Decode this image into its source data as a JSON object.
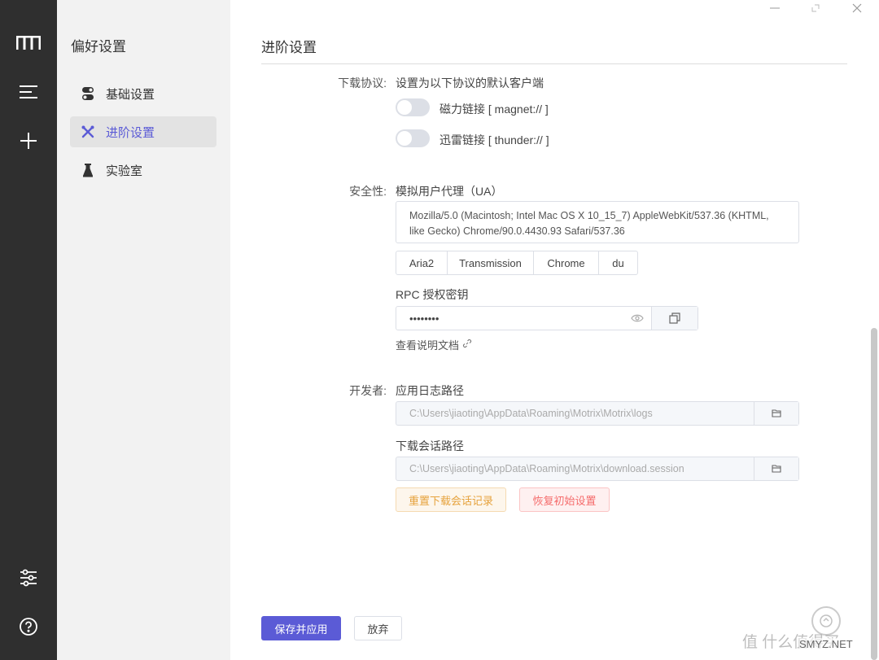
{
  "sidebar": {
    "title": "偏好设置",
    "items": [
      {
        "label": "基础设置",
        "icon": "toggle-icon"
      },
      {
        "label": "进阶设置",
        "icon": "tools-icon"
      },
      {
        "label": "实验室",
        "icon": "flask-icon"
      }
    ]
  },
  "main": {
    "title": "进阶设置",
    "protocol": {
      "label": "下载协议:",
      "description": "设置为以下协议的默认客户端",
      "magnet": "磁力链接 [ magnet:// ]",
      "thunder": "迅雷链接 [ thunder:// ]"
    },
    "security": {
      "label": "安全性:",
      "ua_title": "模拟用户代理（UA）",
      "ua_value": "Mozilla/5.0 (Macintosh; Intel Mac OS X 10_15_7) AppleWebKit/537.36 (KHTML, like Gecko) Chrome/90.0.4430.93 Safari/537.36",
      "ua_presets": [
        "Aria2",
        "Transmission",
        "Chrome",
        "du"
      ],
      "rpc_title": "RPC 授权密钥",
      "rpc_value": "••••••••",
      "docs_link": "查看说明文档"
    },
    "developer": {
      "label": "开发者:",
      "log_title": "应用日志路径",
      "log_path": "C:\\Users\\jiaoting\\AppData\\Roaming\\Motrix\\Motrix\\logs",
      "session_title": "下载会话路径",
      "session_path": "C:\\Users\\jiaoting\\AppData\\Roaming\\Motrix\\download.session",
      "reset_session": "重置下载会话记录",
      "factory_reset": "恢复初始设置"
    }
  },
  "footer": {
    "save": "保存并应用",
    "discard": "放弃"
  },
  "watermark": {
    "text": "值 什么值得买",
    "sub": "SMYZ.NET"
  },
  "colors": {
    "accent": "#5b5bd6",
    "rail": "#2f2f2f",
    "warning": "#e6a23c",
    "danger": "#f56c6c"
  }
}
